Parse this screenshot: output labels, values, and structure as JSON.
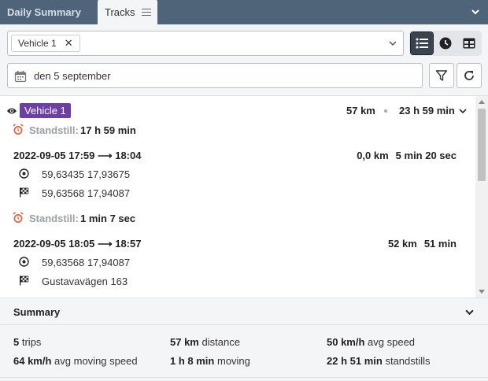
{
  "tabs": [
    {
      "label": "Daily Summary"
    },
    {
      "label": "Tracks"
    }
  ],
  "toolbar": {
    "vehicle_chip": "Vehicle 1",
    "chip_remove": "✕",
    "date": "den 5 september"
  },
  "vehicle": {
    "name": "Vehicle 1",
    "distance": "57 km",
    "duration": "23 h 59 min"
  },
  "events": {
    "stop_label": "Standstill:",
    "stop1": "17 h 59 min",
    "trip1": {
      "time": "2022-09-05 17:59 ⟶ 18:04",
      "distance": "0,0 km",
      "duration": "5 min 20 sec",
      "start": "59,63435 17,93675",
      "end": "59,63568 17,94087"
    },
    "stop2": "1 min 7 sec",
    "trip2": {
      "time": "2022-09-05 18:05 ⟶ 18:57",
      "distance": "52 km",
      "duration": "51 min",
      "start": "59,63568 17,94087",
      "end": "Gustavavägen 163"
    }
  },
  "summary": {
    "title": "Summary",
    "trips_val": "5",
    "trips_lbl": "trips",
    "distance_val": "57 km",
    "distance_lbl": "distance",
    "avg_speed_val": "50 km/h",
    "avg_speed_lbl": "avg speed",
    "avg_moving_val": "64 km/h",
    "avg_moving_lbl": "avg moving speed",
    "moving_val": "1 h 8 min",
    "moving_lbl": "moving",
    "standstill_val": "22 h 51 min",
    "standstill_lbl": "standstills"
  },
  "colors": {
    "tabbar": "#4f6379",
    "vehicle_badge": "#6c3fa6",
    "alarm": "#e8603c"
  },
  "icons": [
    "menu-icon",
    "chevron-down-icon",
    "list-icon",
    "clock-icon",
    "table-icon",
    "calendar-icon",
    "filter-icon",
    "refresh-icon",
    "eye-icon",
    "alarm-clock-icon",
    "start-point-icon",
    "finish-flag-icon"
  ]
}
